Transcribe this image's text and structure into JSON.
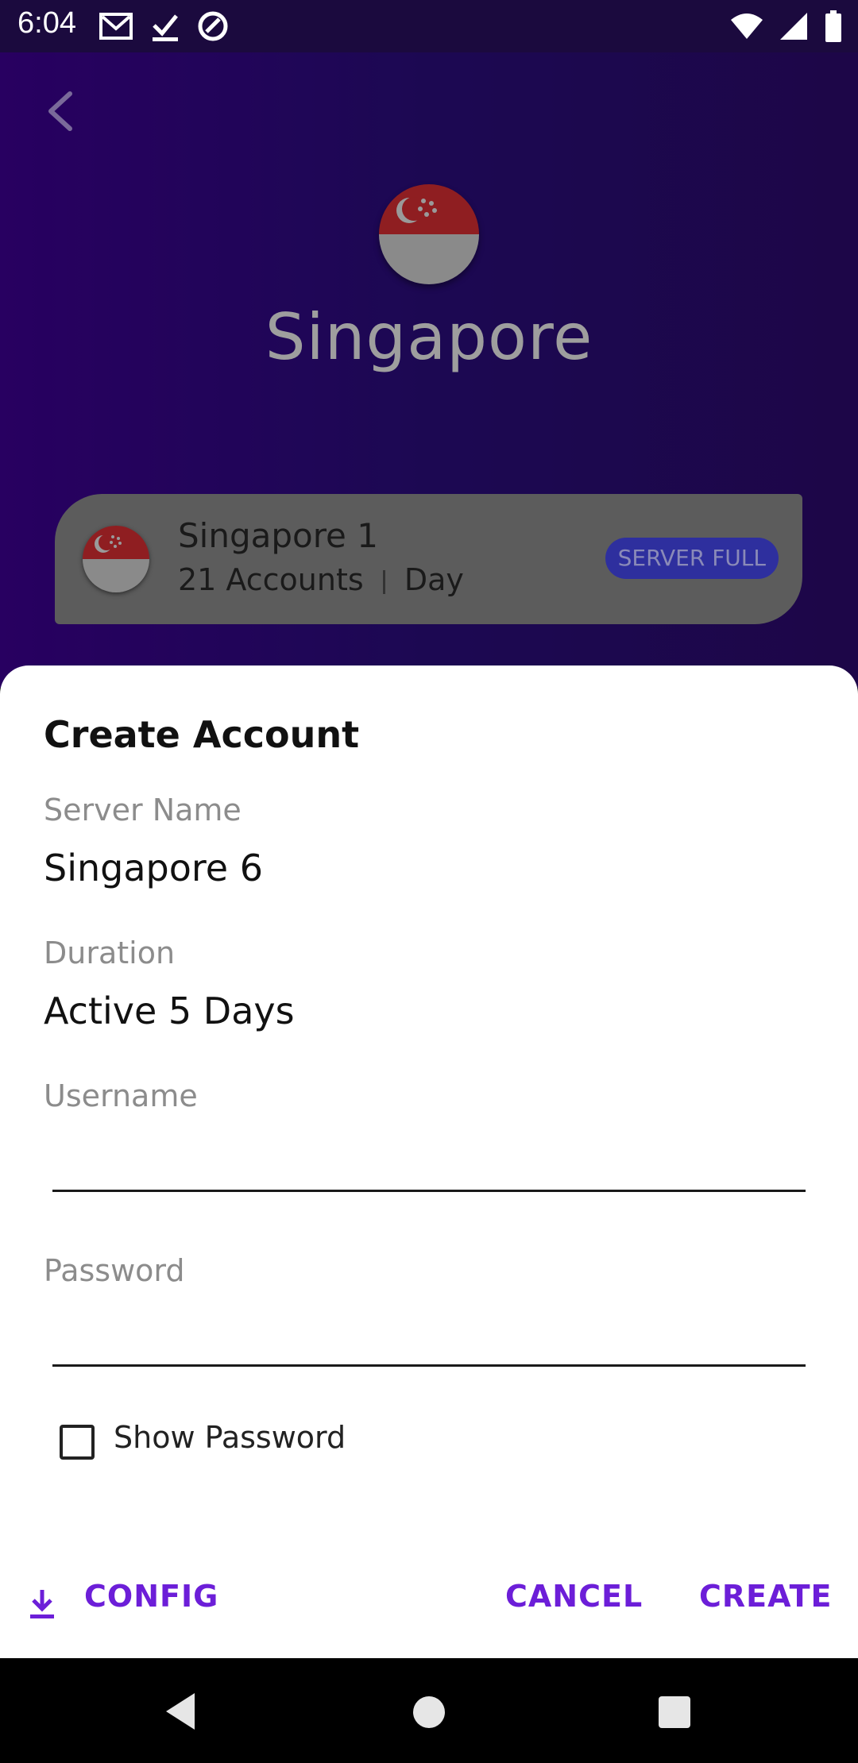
{
  "status_bar": {
    "time": "6:04",
    "left_icons": [
      "gmail-icon",
      "check-icon",
      "at-sign-icon"
    ],
    "right_icons": [
      "wifi-icon",
      "signal-icon",
      "battery-icon"
    ]
  },
  "background": {
    "country_name": "Singapore",
    "server_card": {
      "title": "Singapore 1",
      "subtitle": "21 Accounts",
      "subtitle_suffix": "Day",
      "badge": "SERVER FULL"
    }
  },
  "dialog": {
    "title": "Create Account",
    "server_name_label": "Server Name",
    "server_name_value": "Singapore 6",
    "duration_label": "Duration",
    "duration_value": "Active 5 Days",
    "username_label": "Username",
    "username_value": "",
    "password_label": "Password",
    "password_value": "",
    "show_password_label": "Show Password",
    "show_password_checked": false,
    "buttons": {
      "config": "CONFIG",
      "cancel": "CANCEL",
      "create": "CREATE"
    }
  },
  "colors": {
    "accent": "#6c1ed8",
    "flag_red": "#8f1e21",
    "flag_white": "#8a8a8a"
  }
}
